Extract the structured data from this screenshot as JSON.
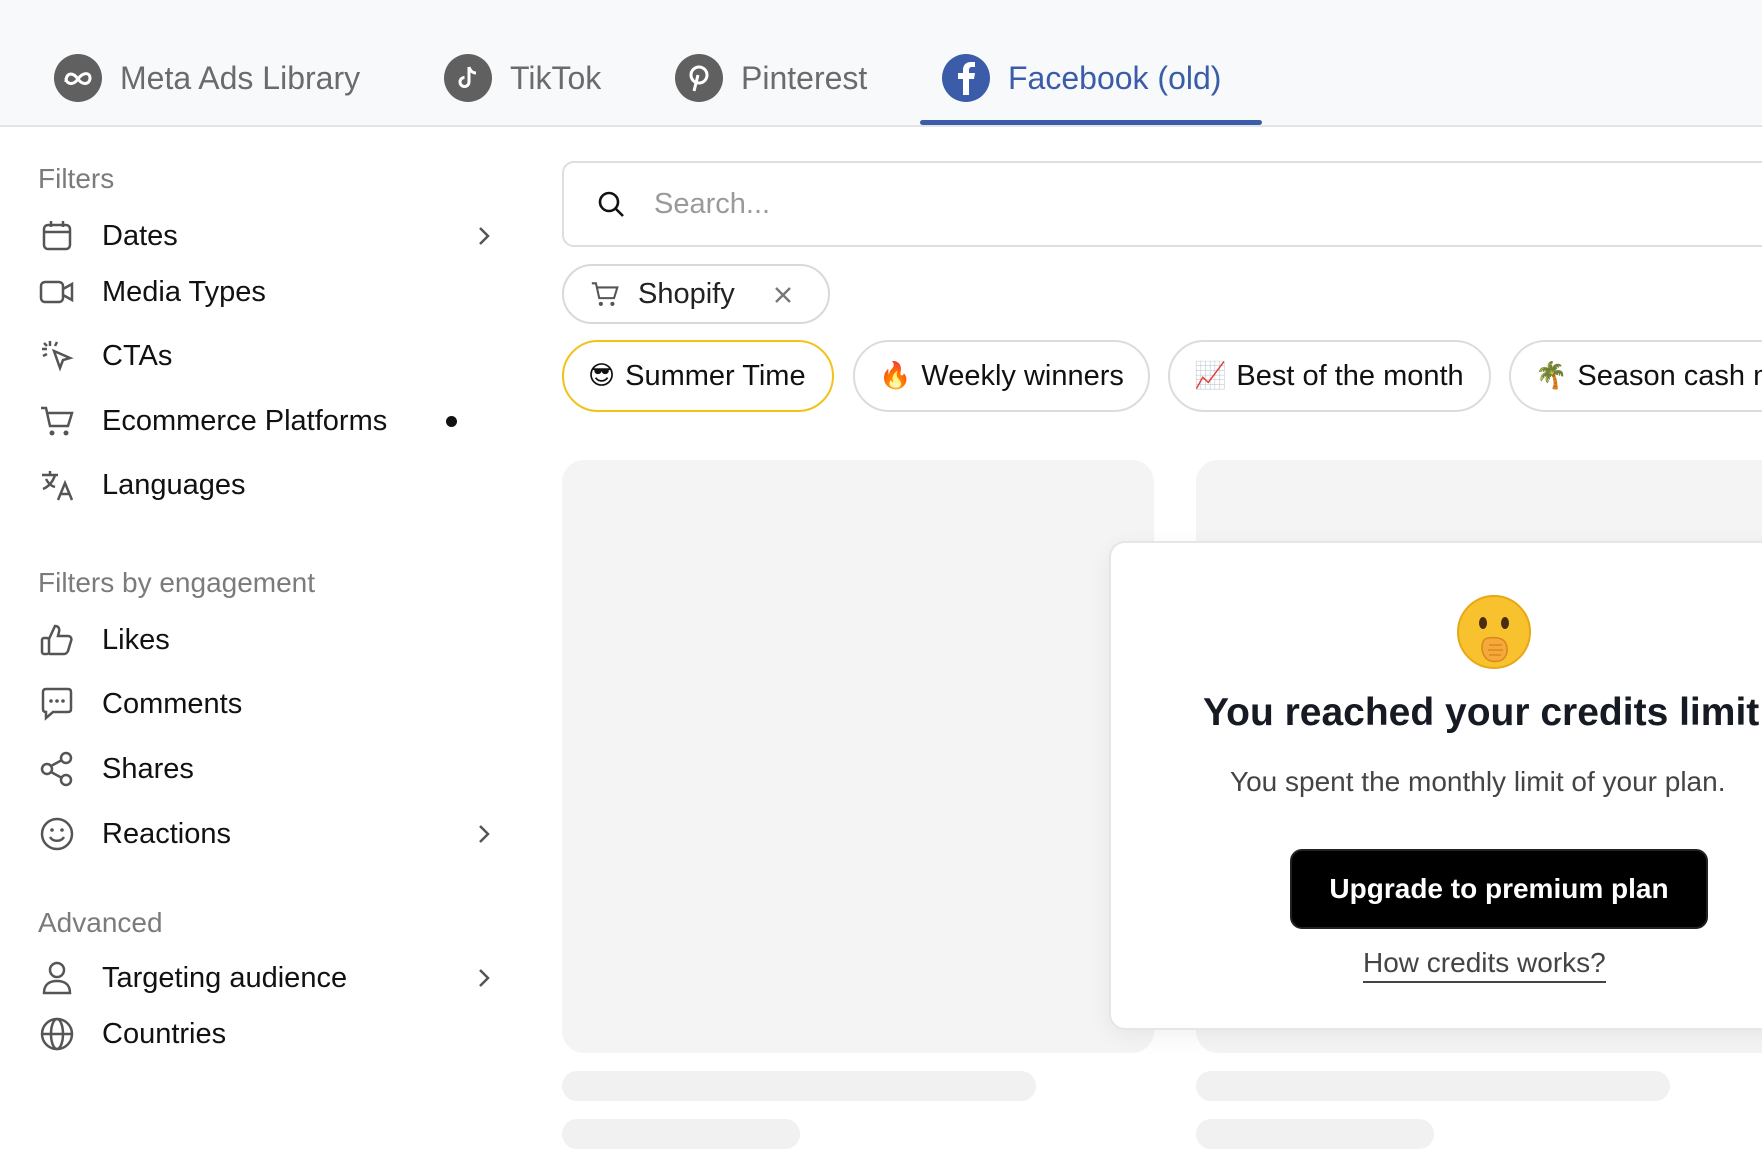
{
  "tabs": [
    {
      "label": "Meta Ads Library",
      "icon": "meta-icon",
      "active": false
    },
    {
      "label": "TikTok",
      "icon": "tiktok-icon",
      "active": false
    },
    {
      "label": "Pinterest",
      "icon": "pinterest-icon",
      "active": false
    },
    {
      "label": "Facebook (old)",
      "icon": "facebook-icon",
      "active": true
    }
  ],
  "sidebar": {
    "filters_title": "Filters",
    "filters": [
      {
        "label": "Dates",
        "icon": "calendar-icon"
      },
      {
        "label": "Media Types",
        "icon": "video-icon"
      },
      {
        "label": "CTAs",
        "icon": "cursor-click-icon"
      },
      {
        "label": "Ecommerce Platforms",
        "icon": "cart-icon",
        "active_indicator": true
      },
      {
        "label": "Languages",
        "icon": "translate-icon"
      }
    ],
    "engagement_title": "Filters by engagement",
    "engagement": [
      {
        "label": "Likes",
        "icon": "thumbs-up-icon"
      },
      {
        "label": "Comments",
        "icon": "comment-icon"
      },
      {
        "label": "Shares",
        "icon": "share-icon"
      },
      {
        "label": "Reactions",
        "icon": "smiley-icon"
      }
    ],
    "advanced_title": "Advanced",
    "advanced": [
      {
        "label": "Targeting audience",
        "icon": "user-icon"
      },
      {
        "label": "Countries",
        "icon": "globe-icon"
      }
    ]
  },
  "search": {
    "placeholder": "Search...",
    "value": ""
  },
  "active_filter_chip": {
    "label": "Shopify",
    "icon": "cart-icon"
  },
  "presets": [
    {
      "emoji": "😎",
      "label": "Summer Time",
      "selected": true
    },
    {
      "emoji": "🔥",
      "label": "Weekly winners",
      "selected": false
    },
    {
      "emoji": "📈",
      "label": "Best of the month",
      "selected": false
    },
    {
      "emoji": "🌴",
      "label": "Season cash m",
      "selected": false
    }
  ],
  "modal": {
    "emoji": "face-with-hand-over-mouth",
    "title": "You reached your credits limit",
    "subtitle": "You spent the monthly limit of your plan.",
    "button_label": "Upgrade to premium plan",
    "link_label": "How credits works?"
  },
  "colors": {
    "accent_blue": "#3b5ca8",
    "selected_chip_border": "#f2c21b",
    "button_bg": "#000000",
    "skeleton": "#f4f4f4"
  }
}
